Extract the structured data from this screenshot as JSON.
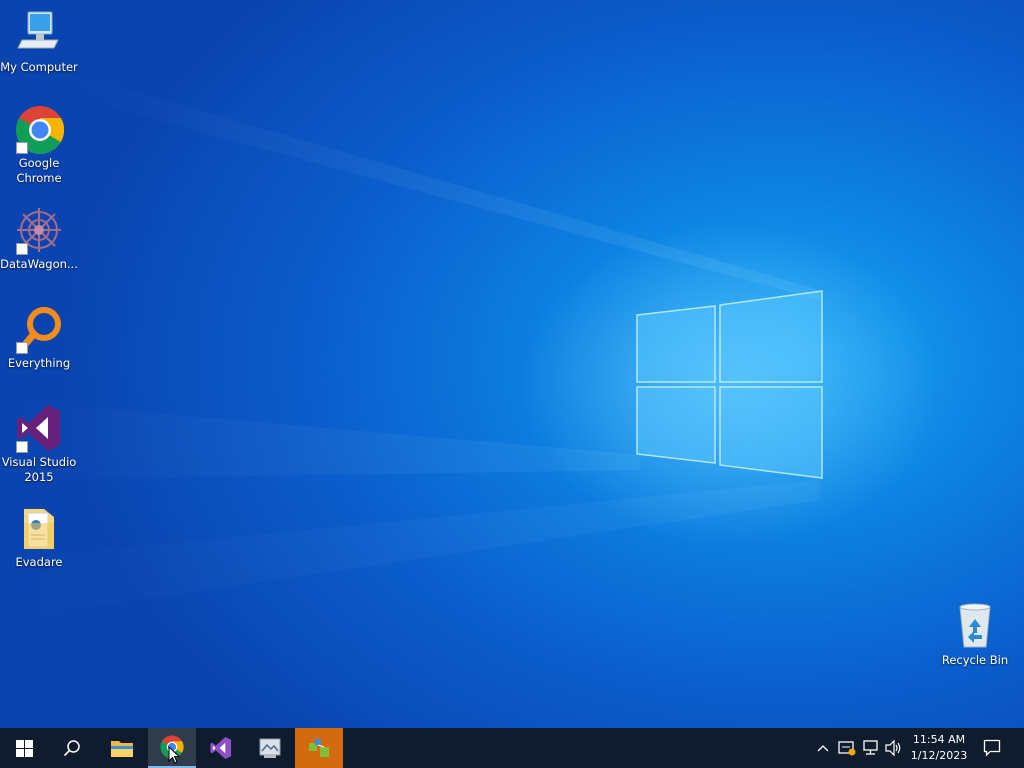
{
  "desktop": {
    "icons": [
      {
        "name": "my-computer",
        "label": "My Computer",
        "icon": "computer-icon",
        "shortcut": false
      },
      {
        "name": "google-chrome",
        "label": "Google\nChrome",
        "icon": "chrome-icon",
        "shortcut": true
      },
      {
        "name": "datawagon",
        "label": "DataWagon...",
        "icon": "datawagon-icon",
        "shortcut": true
      },
      {
        "name": "everything",
        "label": "Everything",
        "icon": "everything-search-icon",
        "shortcut": true
      },
      {
        "name": "visual-studio-2015",
        "label": "Visual Studio\n2015",
        "icon": "visual-studio-icon",
        "shortcut": true
      },
      {
        "name": "evadare",
        "label": "Evadare",
        "icon": "folder-icon",
        "shortcut": false
      },
      {
        "name": "recycle-bin",
        "label": "Recycle Bin",
        "icon": "recycle-bin-icon",
        "shortcut": false
      }
    ]
  },
  "taskbar": {
    "start": {
      "icon": "windows-start-icon"
    },
    "search": {
      "icon": "search-icon"
    },
    "pinned": [
      {
        "name": "file-explorer",
        "icon": "folder-icon",
        "active": false
      },
      {
        "name": "google-chrome",
        "icon": "chrome-icon",
        "active": true
      },
      {
        "name": "visual-studio",
        "icon": "visual-studio-icon",
        "active": false
      },
      {
        "name": "image-viewer",
        "icon": "image-viewer-icon",
        "active": false
      },
      {
        "name": "network-app",
        "icon": "network-app-icon",
        "active": true
      }
    ],
    "tray": {
      "icons": [
        "chevron-up-icon",
        "security-icon",
        "network-icon",
        "volume-icon"
      ]
    },
    "clock": {
      "time": "11:54 AM",
      "date": "1/12/2023"
    },
    "action_center": {
      "icon": "notification-icon"
    }
  },
  "colors": {
    "desktop_accent": "#0b7be3",
    "taskbar_bg": "#0f1c2e",
    "active_task_orange": "#d46a10"
  }
}
